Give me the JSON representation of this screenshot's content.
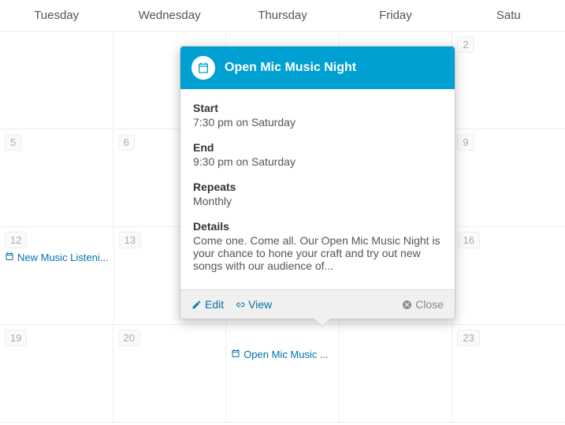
{
  "day_headers": [
    "Tuesday",
    "Wednesday",
    "Thursday",
    "Friday",
    "Satu"
  ],
  "weeks": [
    {
      "cells": [
        {
          "num": ""
        },
        {
          "num": ""
        },
        {
          "num": ""
        },
        {
          "num": ""
        },
        {
          "num": "2"
        }
      ]
    },
    {
      "cells": [
        {
          "num": "5"
        },
        {
          "num": "6"
        },
        {
          "num": ""
        },
        {
          "num": ""
        },
        {
          "num": "9"
        }
      ]
    },
    {
      "cells": [
        {
          "num": "12",
          "event": "New Music Listeni..."
        },
        {
          "num": "13"
        },
        {
          "num": ""
        },
        {
          "num": ""
        },
        {
          "num": "16"
        }
      ]
    },
    {
      "cells": [
        {
          "num": "19"
        },
        {
          "num": "20"
        },
        {
          "num": "",
          "event": "Open Mic Music ..."
        },
        {
          "num": ""
        },
        {
          "num": "23"
        }
      ]
    }
  ],
  "popover": {
    "title": "Open Mic Music Night",
    "start_label": "Start",
    "start_value": "7:30 pm on Saturday",
    "end_label": "End",
    "end_value": "9:30 pm on Saturday",
    "repeats_label": "Repeats",
    "repeats_value": "Monthly",
    "details_label": "Details",
    "details_value": "Come one. Come all.  Our Open Mic Music Night is your chance to hone your craft and try out new songs with our audience of...",
    "edit_label": "Edit",
    "view_label": "View",
    "close_label": "Close"
  }
}
